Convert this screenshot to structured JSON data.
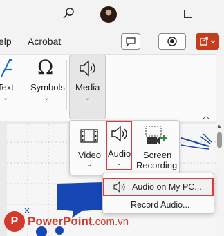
{
  "tabs": {
    "help": "elp",
    "acrobat": "Acrobat"
  },
  "ribbon": {
    "text_label": "Text",
    "symbols_label": "Symbols",
    "media_label": "Media",
    "symbol_glyph": "Ω"
  },
  "media_popup": {
    "video_label": "Video",
    "audio_label": "Audio",
    "screen_recording_label_1": "Screen",
    "screen_recording_label_2": "Recording"
  },
  "audio_menu": {
    "items": [
      {
        "label": "Audio on My PC...",
        "icon": "speaker-icon"
      },
      {
        "label": "Record Audio..."
      }
    ]
  },
  "watermark": {
    "brand": "PowerPoint",
    "domain": ".com.vn",
    "logo_letter": "P"
  },
  "colors": {
    "highlight": "#e03b3b",
    "accent": "#c43e1c",
    "brand": "#d33a2c"
  }
}
